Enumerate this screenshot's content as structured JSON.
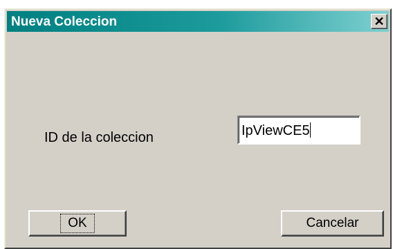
{
  "window": {
    "title": "Nueva Coleccion",
    "close_glyph": "✕"
  },
  "form": {
    "label": "ID de la coleccion",
    "input_value": "IpViewCE5"
  },
  "buttons": {
    "ok_label": "OK",
    "cancel_label": "Cancelar"
  },
  "colors": {
    "titlebar_start": "#008080",
    "titlebar_end": "#7fd0d0",
    "face": "#d4d0c8"
  }
}
